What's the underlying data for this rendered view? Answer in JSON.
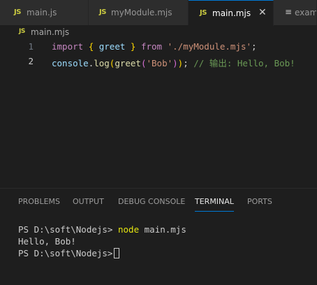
{
  "tabs": [
    {
      "icon": "JS",
      "label": "main.js",
      "active": false
    },
    {
      "icon": "JS",
      "label": "myModule.mjs",
      "active": false
    },
    {
      "icon": "JS",
      "label": "main.mjs",
      "active": true,
      "close": "✕"
    },
    {
      "icon": "≡",
      "label": "exam",
      "active": false
    }
  ],
  "breadcrumb": {
    "icon": "JS",
    "label": "main.mjs"
  },
  "editor": {
    "lines": [
      {
        "number": "1",
        "tokens": {
          "import": "import",
          "open_brace": "{",
          "name": "greet",
          "close_brace": "}",
          "from": "from",
          "path": "'./myModule.mjs'",
          "semi": ";"
        }
      },
      {
        "number": "2",
        "tokens": {
          "console": "console",
          "dot": ".",
          "log": "log",
          "paren_open": "(",
          "greet": "greet",
          "paren_open2": "(",
          "arg": "'Bob'",
          "paren_close2": ")",
          "paren_close": ")",
          "semi": ";",
          "comment": "// 输出: Hello, Bob!"
        }
      }
    ]
  },
  "panel": {
    "tabs": [
      "PROBLEMS",
      "OUTPUT",
      "DEBUG CONSOLE",
      "TERMINAL",
      "PORTS"
    ],
    "active_tab": "TERMINAL"
  },
  "terminal": {
    "prompt1": "PS D:\\soft\\Nodejs>",
    "command_node": "node",
    "command_arg": "main.mjs",
    "output": "Hello, Bob!",
    "prompt2": "PS D:\\soft\\Nodejs>"
  },
  "colors": {
    "accent": "#0078d4",
    "js_icon": "#cbcb41",
    "keyword": "#c586c0",
    "string": "#ce9178",
    "comment": "#6a9955",
    "function": "#dcdcaa",
    "variable": "#9cdcfe"
  }
}
